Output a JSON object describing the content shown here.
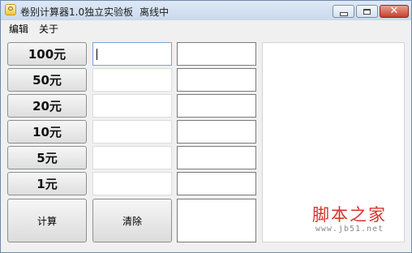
{
  "window": {
    "title": "卷别计算器1.0独立实验板",
    "status": "离线中",
    "controls": {
      "minimize_icon": "minimize-icon",
      "maximize_icon": "maximize-icon",
      "close_icon": "close-icon",
      "close_glyph": "✕"
    }
  },
  "menu": {
    "edit": "编辑",
    "about": "关于"
  },
  "denominations": [
    {
      "label": "100元",
      "count": "",
      "amount": ""
    },
    {
      "label": "50元",
      "count": "",
      "amount": ""
    },
    {
      "label": "20元",
      "count": "",
      "amount": ""
    },
    {
      "label": "10元",
      "count": "",
      "amount": ""
    },
    {
      "label": "5元",
      "count": "",
      "amount": ""
    },
    {
      "label": "1元",
      "count": "",
      "amount": ""
    }
  ],
  "actions": {
    "calculate": "计算",
    "clear": "清除"
  },
  "total": "",
  "result": "",
  "watermark": {
    "text": "脚本之家",
    "url": "www.jb51.net"
  },
  "colors": {
    "watermark": "#d8322b",
    "close_button": "#c7402b",
    "titlebar": "#c9d9ec"
  }
}
